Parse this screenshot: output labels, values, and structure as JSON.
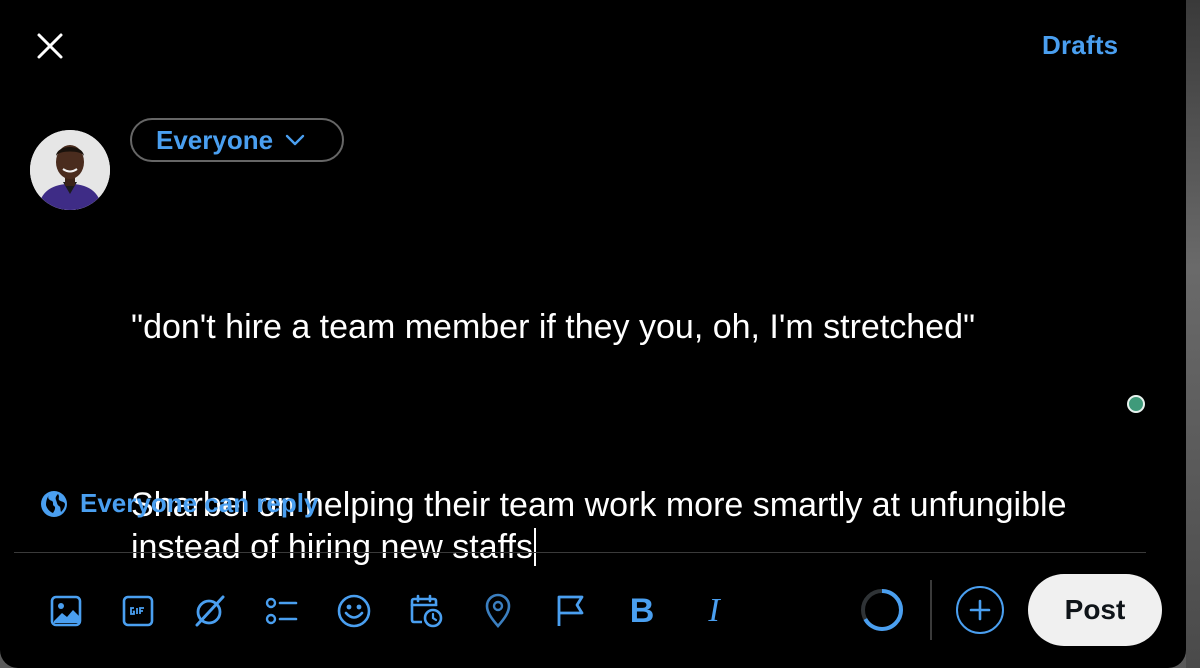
{
  "header": {
    "close_icon": "close-icon",
    "drafts_label": "Drafts"
  },
  "composer": {
    "audience_label": "Everyone",
    "paragraphs": [
      "\"don't hire a team member if they you, oh, I'm stretched\"",
      "Sharbel on helping their team work more smartly at unfungible instead of hiring new staffs"
    ],
    "reply_setting": "Everyone can reply"
  },
  "toolbar": {
    "icons": [
      "image-icon",
      "gif-icon",
      "grok-icon",
      "poll-icon",
      "emoji-icon",
      "schedule-icon",
      "location-icon",
      "flag-icon",
      "bold-icon",
      "italic-icon"
    ],
    "bold_glyph": "B",
    "italic_glyph": "I",
    "post_label": "Post"
  },
  "colors": {
    "background": "#000000",
    "accent": "#4a9ff0",
    "text": "#ffffff",
    "post_button_bg": "#f0f0f0",
    "status_dot": "#3f9a7a"
  }
}
